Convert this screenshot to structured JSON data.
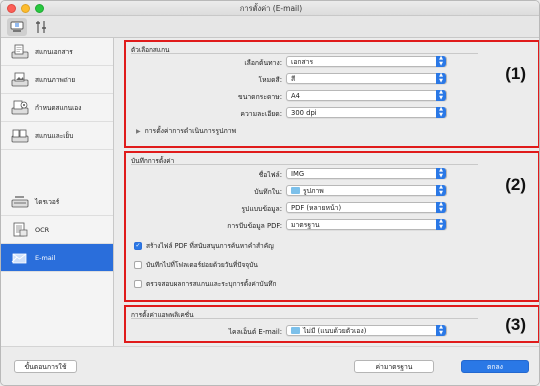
{
  "window": {
    "title": "การตั้งค่า (E-mail)"
  },
  "toolbar": {
    "tab_scan_icon": "scan-from-computer-icon",
    "tab_general_icon": "general-settings-icon"
  },
  "sidebar": {
    "items": [
      {
        "label": "สแกนเอกสาร",
        "icon": "document-scan-icon"
      },
      {
        "label": "สแกนภาพถ่าย",
        "icon": "photo-scan-icon"
      },
      {
        "label": "กำหนดสแกนเอง",
        "icon": "custom-scan-icon"
      },
      {
        "label": "สแกนและเย็บ",
        "icon": "scan-and-stitch-icon"
      },
      {
        "label": "ไดรเวอร์",
        "icon": "driver-icon"
      },
      {
        "label": "OCR",
        "icon": "ocr-icon"
      },
      {
        "label": "E-mail",
        "icon": "email-icon"
      }
    ],
    "selected": "E-mail"
  },
  "scan_options": {
    "title": "ตัวเลือกสแกน",
    "callout": "(1)",
    "source_label": "เลือกต้นทาง:",
    "source_value": "เอกสาร",
    "color_mode_label": "โหมดสี:",
    "color_mode_value": "สี",
    "paper_size_label": "ขนาดกระดาษ:",
    "paper_size_value": "A4",
    "resolution_label": "ความละเอียด:",
    "resolution_value": "300 dpi",
    "image_processing_label": "การตั้งค่าการดำเนินการรูปภาพ"
  },
  "save_settings": {
    "title": "บันทึกการตั้งค่า",
    "callout": "(2)",
    "file_name_label": "ชื่อไฟล์:",
    "file_name_value": "IMG",
    "save_in_label": "บันทึกใน:",
    "save_in_value": "รูปภาพ",
    "data_format_label": "รูปแบบข้อมูล:",
    "data_format_value": "PDF (หลายหน้า)",
    "pdf_compression_label": "การบีบข้อมูล PDF:",
    "pdf_compression_value": "มาตรฐาน",
    "check_keyword_pdf": "สร้างไฟล์ PDF ที่สนับสนุนการค้นหาคำสำคัญ",
    "check_subfolder": "บันทึกไปที่โฟลเดอร์ย่อยด้วยวันที่ปัจจุบัน",
    "check_confirm": "ตรวจสอบผลการสแกนและระบุการตั้งค่าบันทึก",
    "check_keyword_pdf_checked": true,
    "check_subfolder_checked": false,
    "check_confirm_checked": false
  },
  "app_settings": {
    "title": "การตั้งค่าแอพพลิเคชั่น",
    "callout": "(3)",
    "email_client_label": "ไคลเอ็นต์ E-mail:",
    "email_client_value": "ไม่มี (แนบด้วยตัวเอง)"
  },
  "footer": {
    "instructions_label": "ขั้นตอนการใช้",
    "defaults_label": "ค่ามาตรฐาน",
    "ok_label": "ตกลง"
  },
  "colors": {
    "accent": "#2a78e6",
    "highlight_border": "#e01b1b"
  }
}
